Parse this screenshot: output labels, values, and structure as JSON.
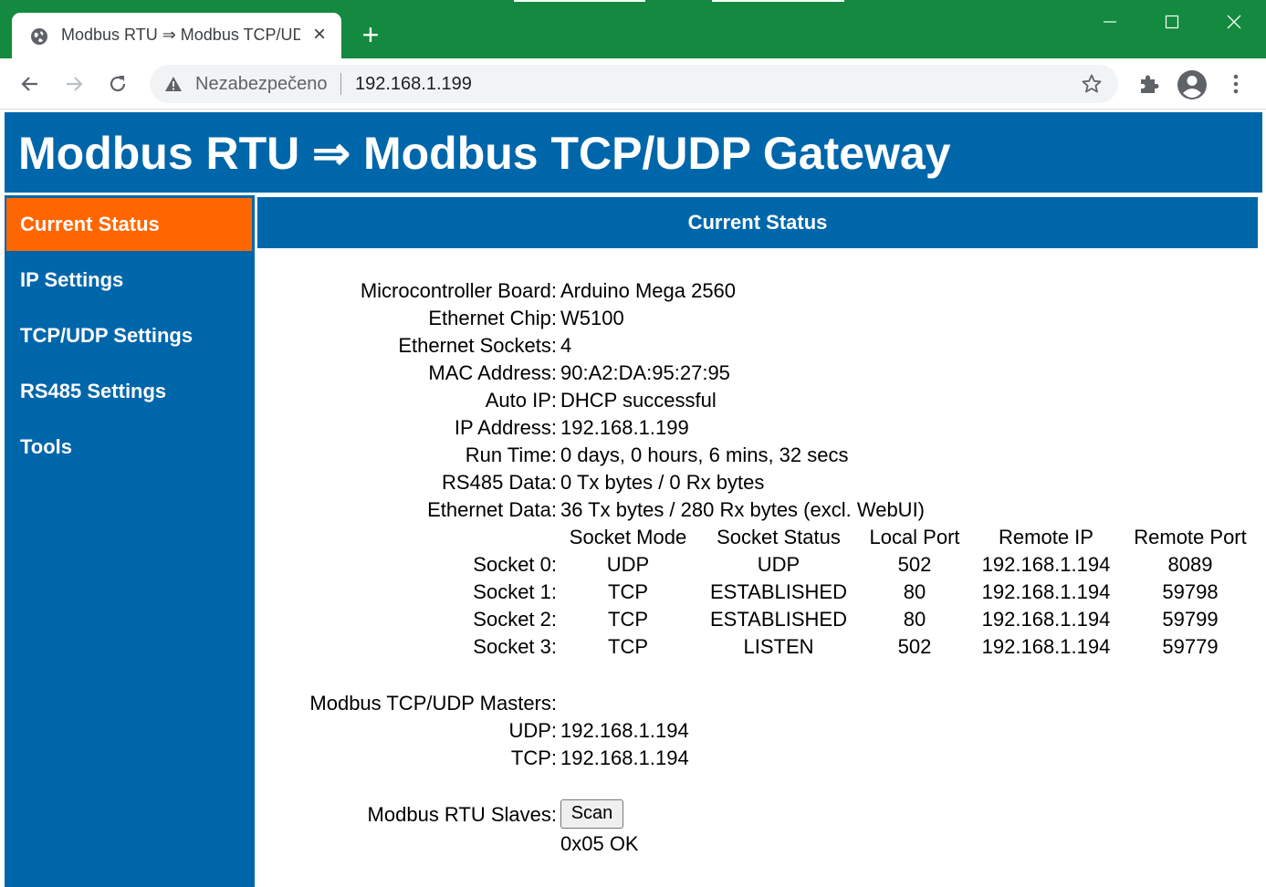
{
  "browser": {
    "tab_title": "Modbus RTU ⇒ Modbus TCP/UDP Gateway",
    "insecure_label": "Nezabezpečeno",
    "url": "192.168.1.199"
  },
  "page": {
    "header_title": "Modbus RTU ⇒ Modbus TCP/UDP Gateway",
    "content_title": "Current Status",
    "nav": [
      {
        "label": "Current Status",
        "active": true
      },
      {
        "label": "IP Settings",
        "active": false
      },
      {
        "label": "TCP/UDP Settings",
        "active": false
      },
      {
        "label": "RS485 Settings",
        "active": false
      },
      {
        "label": "Tools",
        "active": false
      }
    ],
    "status": [
      {
        "label": "Microcontroller Board:",
        "value": "Arduino Mega 2560"
      },
      {
        "label": "Ethernet Chip:",
        "value": "W5100"
      },
      {
        "label": "Ethernet Sockets:",
        "value": "4"
      },
      {
        "label": "MAC Address:",
        "value": "90:A2:DA:95:27:95"
      },
      {
        "label": "Auto IP:",
        "value": "DHCP successful"
      },
      {
        "label": "IP Address:",
        "value": "192.168.1.199"
      },
      {
        "label": "Run Time:",
        "value": "0 days, 0 hours, 6 mins, 32 secs"
      },
      {
        "label": "RS485 Data:",
        "value": "0 Tx bytes / 0 Rx bytes"
      },
      {
        "label": "Ethernet Data:",
        "value": "36 Tx bytes / 280 Rx bytes (excl. WebUI)"
      }
    ],
    "sockets": {
      "headers": [
        "Socket Mode",
        "Socket Status",
        "Local Port",
        "Remote IP",
        "Remote Port"
      ],
      "rows": [
        {
          "label": "Socket 0:",
          "cells": [
            "UDP",
            "UDP",
            "502",
            "192.168.1.194",
            "8089"
          ]
        },
        {
          "label": "Socket 1:",
          "cells": [
            "TCP",
            "ESTABLISHED",
            "80",
            "192.168.1.194",
            "59798"
          ]
        },
        {
          "label": "Socket 2:",
          "cells": [
            "TCP",
            "ESTABLISHED",
            "80",
            "192.168.1.194",
            "59799"
          ]
        },
        {
          "label": "Socket 3:",
          "cells": [
            "TCP",
            "LISTEN",
            "502",
            "192.168.1.194",
            "59779"
          ]
        }
      ]
    },
    "masters": {
      "label": "Modbus TCP/UDP Masters:",
      "items": [
        {
          "label": "UDP:",
          "value": "192.168.1.194"
        },
        {
          "label": "TCP:",
          "value": "192.168.1.194"
        }
      ]
    },
    "slaves": {
      "label": "Modbus RTU Slaves:",
      "button": "Scan",
      "result": "0x05 OK"
    }
  }
}
